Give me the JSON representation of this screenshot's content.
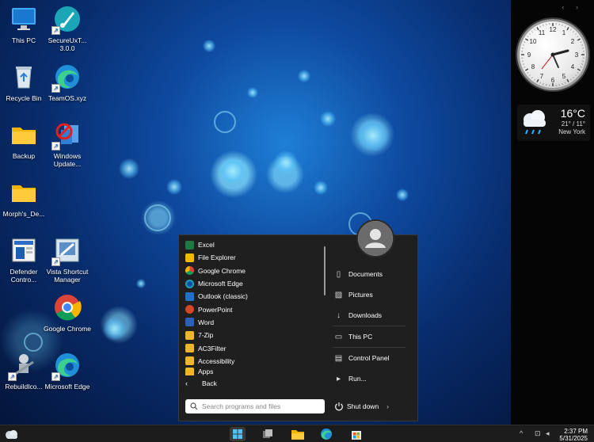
{
  "desktop_icons": [
    {
      "label": "This PC",
      "icon": "monitor-icon"
    },
    {
      "label": "SecureUxT... 3.0.0",
      "icon": "secureux-icon"
    },
    {
      "label": "Recycle Bin",
      "icon": "recycle-bin-icon"
    },
    {
      "label": "TeamOS.xyz",
      "icon": "edge-icon"
    },
    {
      "label": "Backup",
      "icon": "folder-icon"
    },
    {
      "label": "Windows Update...",
      "icon": "windows-update-icon"
    },
    {
      "label": "Morph's_De...",
      "icon": "folder-icon"
    },
    {
      "label": "Defender Contro...",
      "icon": "defender-icon"
    },
    {
      "label": "Vista Shortcut Manager",
      "icon": "shortcut-manager-icon"
    },
    {
      "label": "Google Chrome",
      "icon": "chrome-icon"
    },
    {
      "label": "RebuildIco...",
      "icon": "rebuild-icon"
    },
    {
      "label": "Microsoft Edge",
      "icon": "edge-icon"
    }
  ],
  "clock": {
    "numbers": [
      "12",
      "1",
      "2",
      "3",
      "4",
      "5",
      "6",
      "7",
      "8",
      "9",
      "10",
      "11"
    ]
  },
  "weather": {
    "temp": "16°C",
    "range": "21° / 11°",
    "city": "New York"
  },
  "start_menu": {
    "programs": [
      {
        "label": "Excel",
        "color": "#1d7a44"
      },
      {
        "label": "File Explorer",
        "color": "#f2b800"
      },
      {
        "label": "Google Chrome",
        "color": "#e04a3a"
      },
      {
        "label": "Microsoft Edge",
        "color": "#1fa0c8"
      },
      {
        "label": "Outlook (classic)",
        "color": "#1e73c8"
      },
      {
        "label": "PowerPoint",
        "color": "#d24726"
      },
      {
        "label": "Word",
        "color": "#2b5fb8"
      },
      {
        "label": "7-Zip",
        "color": "#f0b429"
      },
      {
        "label": "AC3Filter",
        "color": "#f0b429"
      },
      {
        "label": "Accessibility",
        "color": "#f0b429"
      },
      {
        "label": "Apps",
        "color": "#f0b429"
      }
    ],
    "back_label": "Back",
    "right_items": [
      {
        "label": "Documents",
        "icon": "document-icon",
        "glyph": "▯"
      },
      {
        "label": "Pictures",
        "icon": "picture-icon",
        "glyph": "▨"
      },
      {
        "label": "Downloads",
        "icon": "download-icon",
        "glyph": "↓"
      },
      {
        "label": "This PC",
        "icon": "monitor-icon",
        "glyph": "▭"
      },
      {
        "label": "Control Panel",
        "icon": "control-panel-icon",
        "glyph": "▤"
      },
      {
        "label": "Run...",
        "icon": "run-icon",
        "glyph": "▸"
      }
    ],
    "search_placeholder": "Search programs and files",
    "shutdown_label": "Shut down"
  },
  "taskbar": {
    "time": "2:37 PM",
    "date": "5/31/2025"
  }
}
